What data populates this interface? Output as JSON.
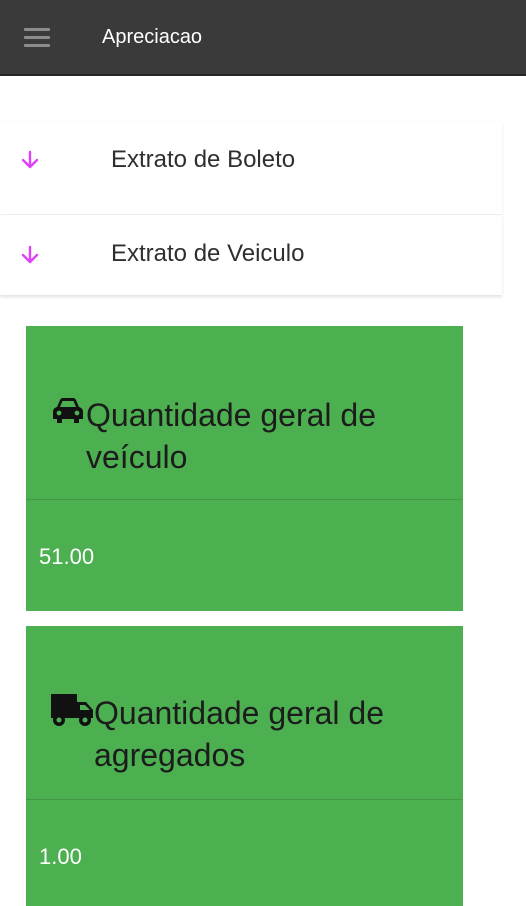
{
  "appbar": {
    "title": "Apreciacao",
    "menu_icon": "hamburger-menu-icon"
  },
  "panels": [
    {
      "label": "Extrato de Boleto",
      "icon": "arrow-down-icon",
      "icon_color": "#e040fb"
    },
    {
      "label": "Extrato de Veiculo",
      "icon": "arrow-down-icon",
      "icon_color": "#e040fb"
    }
  ],
  "cards": [
    {
      "icon": "car-icon",
      "title_line1": "Quantidade geral de",
      "title_line2": "veículo",
      "value": "51.00",
      "color": "#4caf50"
    },
    {
      "icon": "truck-icon",
      "title_line1": "Quantidade geral de",
      "title_line2": "agregados",
      "value": "1.00",
      "color": "#4caf50"
    }
  ]
}
